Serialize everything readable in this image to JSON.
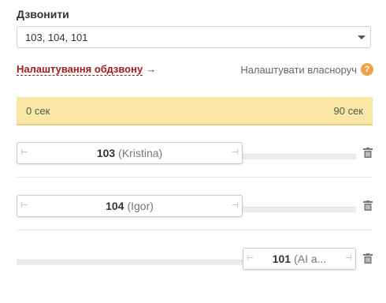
{
  "header": {
    "title": "Дзвонити"
  },
  "select": {
    "value": "103, 104, 101",
    "icon": "chevron-down-icon"
  },
  "links": {
    "settings_label": "Налаштування обдзвону",
    "settings_arrow": "→",
    "manual_label": "Налаштувати власноруч",
    "help_glyph": "?"
  },
  "timebar": {
    "start": "0 сек",
    "end": "90 сек"
  },
  "rows": [
    {
      "ext": "103",
      "name": "(Kristina)"
    },
    {
      "ext": "104",
      "name": "(Igor)"
    },
    {
      "ext": "101",
      "name": "(AI a..."
    }
  ],
  "colors": {
    "accent": "#a11d1d",
    "timebar_bg": "#fbe7a5",
    "help_icon": "#f0a24b"
  }
}
